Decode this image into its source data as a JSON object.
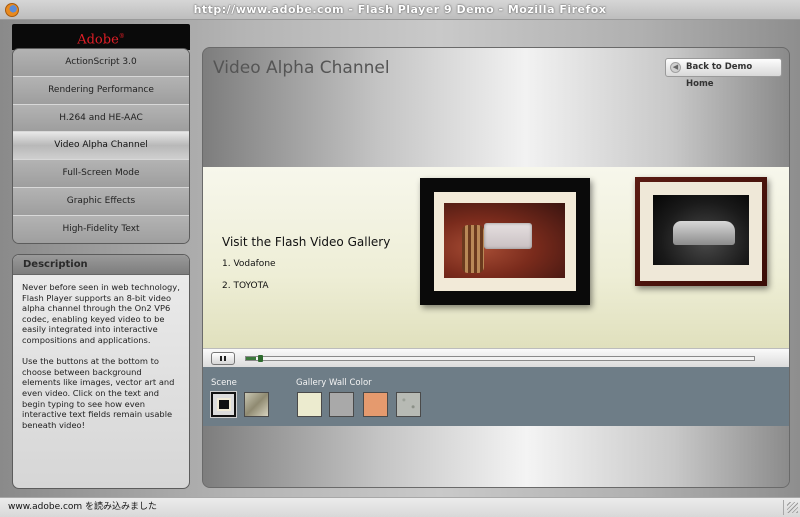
{
  "window": {
    "title": "http://www.adobe.com - Flash Player 9 Demo - Mozilla Firefox"
  },
  "sidebar": {
    "logo": "Adobe",
    "logo_mark": "®",
    "items": [
      {
        "label": "ActionScript 3.0",
        "active": false
      },
      {
        "label": "Rendering Performance",
        "active": false
      },
      {
        "label": "H.264 and HE-AAC",
        "active": false
      },
      {
        "label": "Video Alpha Channel",
        "active": true
      },
      {
        "label": "Full-Screen Mode",
        "active": false
      },
      {
        "label": "Graphic Effects",
        "active": false
      },
      {
        "label": "High-Fidelity Text",
        "active": false
      }
    ]
  },
  "description": {
    "heading": "Description",
    "paragraph1": "Never before seen in web technology, Flash Player supports an 8-bit video alpha channel through the On2 VP6 codec, enabling keyed video to be easily  integrated into interactive compositions and applications.",
    "paragraph2": "Use the buttons at the bottom to choose between background elements like images, vector art and even video. Click on the text and begin typing to see how even interactive text fields remain usable beneath video!"
  },
  "content": {
    "title": "Video Alpha Channel",
    "back_button": "Back to Demo Home",
    "gallery_title": "Visit the Flash Video Gallery",
    "gallery_items": [
      "1. Vodafone",
      "2. TOYOTA"
    ],
    "progress": 0.02
  },
  "options": {
    "scene_label": "Scene",
    "wall_color_label": "Gallery Wall Color",
    "wall_colors": [
      "#ecebcf",
      "#a9a9a9",
      "#e59a6e",
      "#b7bab4"
    ]
  },
  "status": {
    "text": "www.adobe.com を読み込みました"
  }
}
